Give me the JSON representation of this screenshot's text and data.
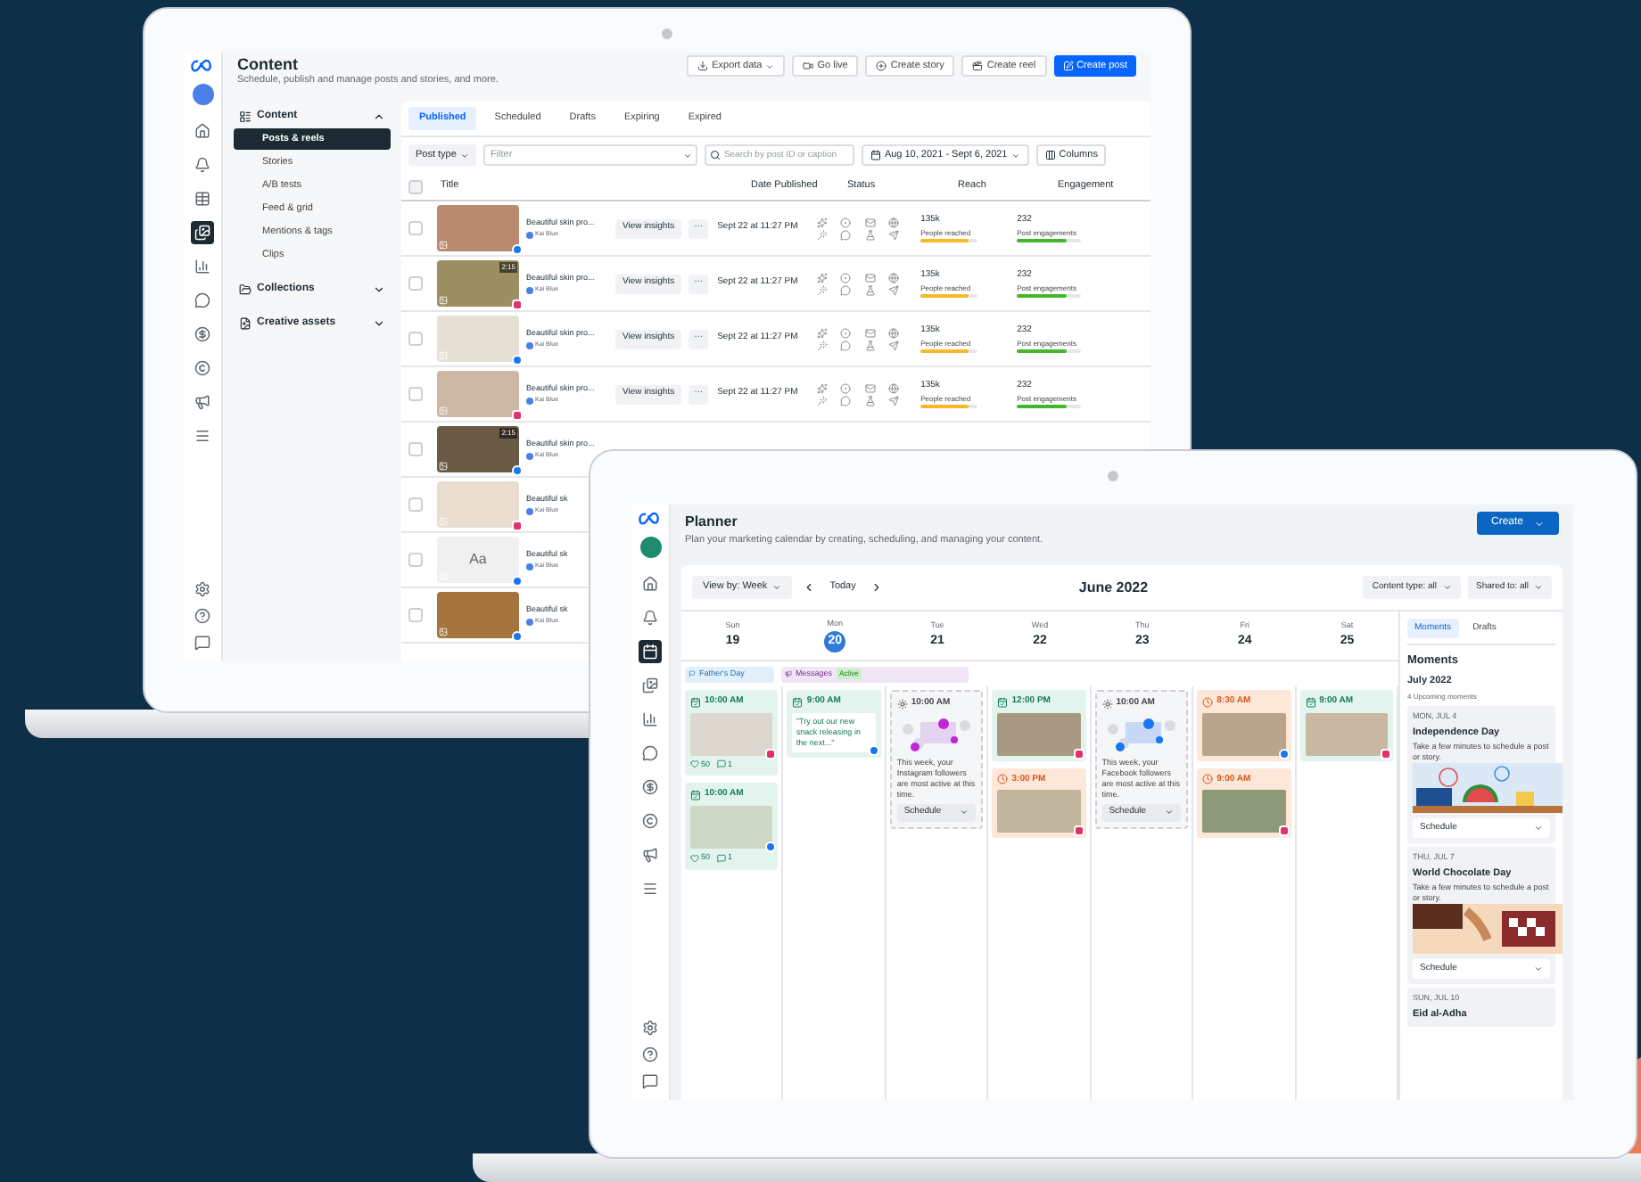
{
  "back_window": {
    "title": "Content",
    "subtitle": "Schedule, publish and manage posts and stories, and more.",
    "actions": [
      {
        "label": "Export data",
        "kind": "dropdown"
      },
      {
        "label": "Go live",
        "kind": "button"
      },
      {
        "label": "Create story",
        "kind": "button"
      },
      {
        "label": "Create reel",
        "kind": "button"
      },
      {
        "label": "Create post",
        "kind": "primary"
      }
    ],
    "rail": [
      {
        "selected": false
      },
      {
        "selected": false
      },
      {
        "selected": false
      },
      {
        "selected": true
      },
      {
        "selected": false
      },
      {
        "selected": false
      },
      {
        "selected": false
      },
      {
        "selected": false
      },
      {
        "selected": false
      },
      {
        "selected": false
      }
    ],
    "nav": [
      {
        "label": "Content",
        "expanded": true,
        "children": [
          {
            "label": "Posts & reels",
            "selected": true
          },
          {
            "label": "Stories",
            "selected": false
          },
          {
            "label": "A/B tests",
            "selected": false
          },
          {
            "label": "Feed & grid",
            "selected": false
          },
          {
            "label": "Mentions & tags",
            "selected": false
          },
          {
            "label": "Clips",
            "selected": false
          }
        ]
      },
      {
        "label": "Collections",
        "expanded": false
      },
      {
        "label": "Creative assets",
        "expanded": false
      }
    ],
    "tabs": [
      {
        "label": "Published",
        "selected": true
      },
      {
        "label": "Scheduled",
        "selected": false
      },
      {
        "label": "Drafts",
        "selected": false
      },
      {
        "label": "Expiring",
        "selected": false
      },
      {
        "label": "Expired",
        "selected": false
      }
    ],
    "filters": {
      "post_type": "Post type",
      "filter_placeholder": "Filter",
      "search_placeholder": "Search by post ID or caption",
      "date_range": "Aug 10, 2021 - Sept 6, 2021",
      "columns": "Columns"
    },
    "table": {
      "header_checked": false,
      "columns": [
        "Title",
        "Date Published",
        "Status",
        "Reach",
        "Engagement"
      ],
      "rows": [
        {
          "checked": false,
          "badge": {
            "kind": "facebook"
          },
          "title": "Beautiful skin pro...",
          "author": "Kai Blue",
          "button": "View insights",
          "more": "···",
          "date": "Sept 22 at 11:27 PM",
          "reach": {
            "value": "135k",
            "caption": "People reached",
            "level": 0.85
          },
          "engagement": {
            "value": "232",
            "caption": "Post engagements",
            "level": 0.78
          }
        },
        {
          "checked": false,
          "badge": {
            "kind": "instagram"
          },
          "duration": "2:15",
          "title": "Beautiful skin pro...",
          "author": "Kai Blue",
          "button": "View insights",
          "more": "···",
          "date": "Sept 22 at 11:27 PM",
          "reach": {
            "value": "135k",
            "caption": "People reached",
            "level": 0.85
          },
          "engagement": {
            "value": "232",
            "caption": "Post engagements",
            "level": 0.78
          }
        },
        {
          "checked": false,
          "badge": {
            "kind": "facebook"
          },
          "title": "Beautiful skin pro...",
          "author": "Kai Blue",
          "button": "View insights",
          "more": "···",
          "date": "Sept 22 at 11:27 PM",
          "reach": {
            "value": "135k",
            "caption": "People reached",
            "level": 0.85
          },
          "engagement": {
            "value": "232",
            "caption": "Post engagements",
            "level": 0.78
          }
        },
        {
          "checked": false,
          "badge": {
            "kind": "instagram"
          },
          "title": "Beautiful skin pro...",
          "author": "Kai Blue",
          "button": "View insights",
          "more": "···",
          "date": "Sept 22 at 11:27 PM",
          "reach": {
            "value": "135k",
            "caption": "People reached",
            "level": 0.85
          },
          "engagement": {
            "value": "232",
            "caption": "Post engagements",
            "level": 0.78
          }
        },
        {
          "checked": false,
          "badge": {
            "kind": "facebook"
          },
          "duration": "2:15",
          "title": "Beautiful skin pro...",
          "author": "Kai Blue"
        },
        {
          "checked": false,
          "badge": {
            "kind": "instagram"
          },
          "title": "Beautiful sk",
          "author": "Kai Blue"
        },
        {
          "checked": false,
          "badge": {
            "kind": "facebook"
          },
          "thumbnail_text": "Aa",
          "title": "Beautiful sk",
          "author": "Kai Blue"
        },
        {
          "checked": false,
          "badge": {
            "kind": "facebook"
          },
          "title": "Beautiful sk",
          "author": "Kai Blue"
        }
      ]
    }
  },
  "front_window": {
    "title": "Planner",
    "subtitle": "Plan your marketing calendar by creating, scheduling, and managing your content.",
    "create_button": "Create",
    "rail": [
      {
        "selected": false
      },
      {
        "selected": false
      },
      {
        "selected": true
      },
      {
        "selected": false
      },
      {
        "selected": false
      },
      {
        "selected": false
      },
      {
        "selected": false
      },
      {
        "selected": false
      },
      {
        "selected": false
      },
      {
        "selected": false
      }
    ],
    "toolbar": {
      "view": "View by: Week",
      "today": "Today",
      "month": "June 2022",
      "content_type": "Content type: all",
      "shared_to": "Shared to: all"
    },
    "days": [
      {
        "weekday": "Sun",
        "date": "19",
        "selected": false
      },
      {
        "weekday": "Mon",
        "date": "20",
        "selected": true
      },
      {
        "weekday": "Tue",
        "date": "21",
        "selected": false
      },
      {
        "weekday": "Wed",
        "date": "22",
        "selected": false
      },
      {
        "weekday": "Thu",
        "date": "23",
        "selected": false
      },
      {
        "weekday": "Fri",
        "date": "24",
        "selected": false
      },
      {
        "weekday": "Sat",
        "date": "25",
        "selected": false
      }
    ],
    "banners": [
      {
        "kind": "event",
        "label": "Father's Day"
      },
      {
        "kind": "campaign",
        "label": "Messages",
        "badge": "Active"
      }
    ],
    "columns": [
      {
        "posts": [
          {
            "kind": "published",
            "time": "10:00 AM",
            "badge": {
              "kind": "instagram"
            },
            "likes": "50",
            "comments": "1"
          },
          {
            "kind": "published",
            "time": "10:00 AM",
            "badge": {
              "kind": "facebook"
            },
            "likes": "50",
            "comments": "1"
          }
        ]
      },
      {
        "posts": [
          {
            "kind": "published",
            "time": "9:00 AM",
            "badge": {
              "kind": "facebook"
            },
            "quote": "\"Try out our new snack releasing in the next...\""
          }
        ]
      },
      {
        "posts": [
          {
            "kind": "suggestion",
            "time": "10:00 AM",
            "badge": {
              "kind": "instagram"
            },
            "text": "This week, your Instagram followers are most active at this time.",
            "button": "Schedule"
          }
        ]
      },
      {
        "posts": [
          {
            "kind": "published",
            "time": "12:00 PM",
            "badge": {
              "kind": "instagram"
            }
          },
          {
            "kind": "scheduled",
            "time": "3:00 PM",
            "badge": {
              "kind": "instagram"
            }
          }
        ]
      },
      {
        "posts": [
          {
            "kind": "suggestion",
            "time": "10:00 AM",
            "badge": {
              "kind": "facebook"
            },
            "text": "This week, your Facebook followers are most active at this time.",
            "button": "Schedule"
          }
        ]
      },
      {
        "posts": [
          {
            "kind": "scheduled",
            "time": "8:30 AM",
            "badge": {
              "kind": "facebook"
            }
          },
          {
            "kind": "scheduled",
            "time": "9:00 AM",
            "badge": {
              "kind": "instagram"
            }
          }
        ]
      },
      {
        "posts": [
          {
            "kind": "published",
            "time": "9:00 AM",
            "badge": {
              "kind": "instagram"
            }
          }
        ]
      }
    ],
    "side_tabs": [
      {
        "label": "Moments",
        "selected": true
      },
      {
        "label": "Drafts",
        "selected": false
      }
    ],
    "moments_heading": "Moments",
    "moments_month": "July 2022",
    "moments_count": "4 Upcoming moments",
    "moments": [
      {
        "date": "MON, JUL 4",
        "title": "Independence Day",
        "text": "Take a few minutes to schedule a post or story.",
        "button": "Schedule"
      },
      {
        "date": "THU, JUL 7",
        "title": "World Chocolate Day",
        "text": "Take a few minutes to schedule a post or story.",
        "button": "Schedule"
      },
      {
        "date": "SUN, JUL 10",
        "title": "Eid al-Adha"
      }
    ]
  }
}
